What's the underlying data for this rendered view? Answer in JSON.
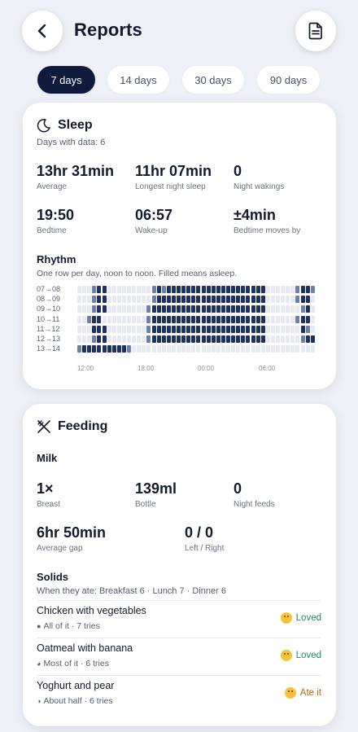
{
  "header": {
    "title": "Reports",
    "back_icon": "chevron-left-icon",
    "report_icon": "document-icon"
  },
  "tabs": [
    {
      "label": "7 days",
      "active": true
    },
    {
      "label": "14 days",
      "active": false
    },
    {
      "label": "30 days",
      "active": false
    },
    {
      "label": "90 days",
      "active": false
    }
  ],
  "sleep": {
    "title": "Sleep",
    "icon": "moon-icon",
    "days_with_data": "Days with data: 6",
    "stats": [
      {
        "value": "13hr 31min",
        "label": "Average"
      },
      {
        "value": "11hr 07min",
        "label": "Longest night sleep"
      },
      {
        "value": "0",
        "label": "Night wakings"
      },
      {
        "value": "19:50",
        "label": "Bedtime"
      },
      {
        "value": "06:57",
        "label": "Wake-up"
      },
      {
        "value": "±4min",
        "label": "Bedtime moves by"
      }
    ],
    "rhythm": {
      "title": "Rhythm",
      "subtitle": "One row per day, noon to noon. Filled means asleep.",
      "rows": [
        "07→08",
        "08→09",
        "09→10",
        "10→11",
        "11→12",
        "12→13",
        "13→14"
      ],
      "ticks": [
        "12:00",
        "18:00",
        "00:00",
        "06:00"
      ],
      "colors": {
        "asleep": "#1e3160",
        "partial": "#6f7fa6",
        "awake": "#e7eaf1"
      }
    }
  },
  "feeding": {
    "title": "Feeding",
    "icon": "utensils-icon",
    "milk_title": "Milk",
    "milk_stats": [
      {
        "value": "1×",
        "label": "Breast"
      },
      {
        "value": "139ml",
        "label": "Bottle"
      },
      {
        "value": "0",
        "label": "Night feeds"
      },
      {
        "value": "6hr 50min",
        "label": "Average gap"
      },
      {
        "value": "0 / 0",
        "label": "Left / Right"
      }
    ],
    "solids_title": "Solids",
    "solids_sub": "When they ate: Breakfast 6 · Lunch 7 · Dinner 6",
    "foods": [
      {
        "name": "Chicken with vegetables",
        "portion": "●",
        "detail": "All of it · 7 tries",
        "reaction": "Loved",
        "reaction_color": "#1f8a5b"
      },
      {
        "name": "Oatmeal with banana",
        "portion": "◕",
        "detail": "Most of it · 6 tries",
        "reaction": "Loved",
        "reaction_color": "#1f8a5b"
      },
      {
        "name": "Yoghurt and pear",
        "portion": "◑",
        "detail": "About half · 6 tries",
        "reaction": "Ate it",
        "reaction_color": "#b26a10"
      }
    ]
  }
}
